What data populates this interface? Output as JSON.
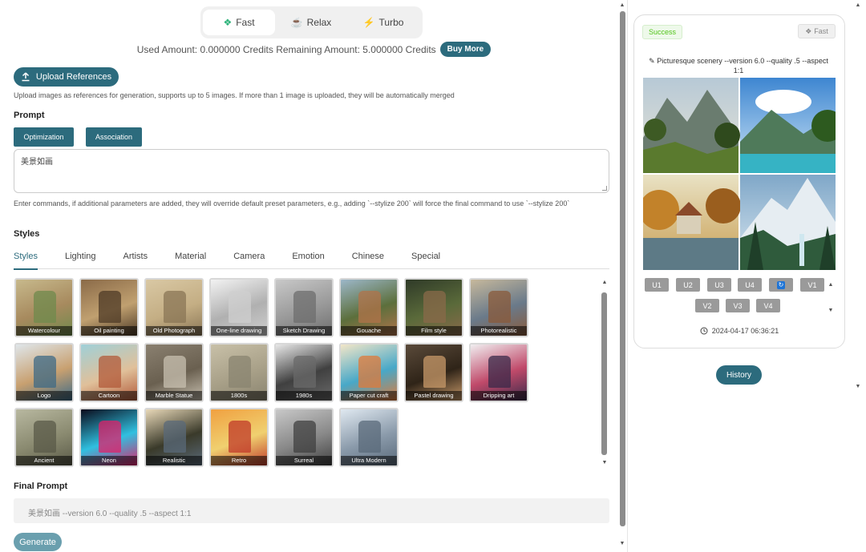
{
  "modes": [
    {
      "label": "Fast",
      "icon": "fast-icon",
      "color": "#2db37a",
      "active": true
    },
    {
      "label": "Relax",
      "icon": "coffee-icon",
      "color": "#b455c8",
      "active": false
    },
    {
      "label": "Turbo",
      "icon": "lightning-icon",
      "color": "#f5a623",
      "active": false
    }
  ],
  "credits": {
    "text": "Used Amount: 0.000000 Credits Remaining Amount: 5.000000 Credits",
    "buy_more": "Buy More"
  },
  "upload": {
    "label": "Upload References",
    "hint": "Upload images as references for generation, supports up to 5 images. If more than 1 image is uploaded, they will be automatically merged"
  },
  "prompt": {
    "heading": "Prompt",
    "optimization": "Optimization",
    "association": "Association",
    "value": "美景如画",
    "hint": "Enter commands, if additional parameters are added, they will override default preset parameters, e.g., adding `--stylize 200` will force the final command to use `--stylize 200`"
  },
  "styles": {
    "heading": "Styles",
    "tabs": [
      "Styles",
      "Lighting",
      "Artists",
      "Material",
      "Camera",
      "Emotion",
      "Chinese",
      "Special"
    ],
    "active_tab": "Styles",
    "items": [
      "Watercolour",
      "Oil painting",
      "Old Photograph",
      "One-line drawing",
      "Sketch Drawing",
      "Gouache",
      "Film style",
      "Photorealistic",
      "Logo",
      "Cartoon",
      "Marble Statue",
      "1800s",
      "1980s",
      "Paper cut craft",
      "Pastel drawing",
      "Dripping art",
      "Ancient",
      "Neon",
      "Realistic",
      "Retro",
      "Surreal",
      "Ultra Modern"
    ]
  },
  "final": {
    "heading": "Final Prompt",
    "value": "美景如画 --version 6.0 --quality .5 --aspect 1:1"
  },
  "generate_label": "Generate",
  "result": {
    "status": "Success",
    "mode": "Fast",
    "prompt": "Picturesque scenery --version 6.0 --quality .5 --aspect 1:1",
    "upscale_buttons": [
      "U1",
      "U2",
      "U3",
      "U4"
    ],
    "variation_buttons": [
      "V1",
      "V2",
      "V3",
      "V4"
    ],
    "timestamp": "2024-04-17 06:36:21"
  },
  "history_label": "History",
  "accent_color": "#2c6b7d"
}
